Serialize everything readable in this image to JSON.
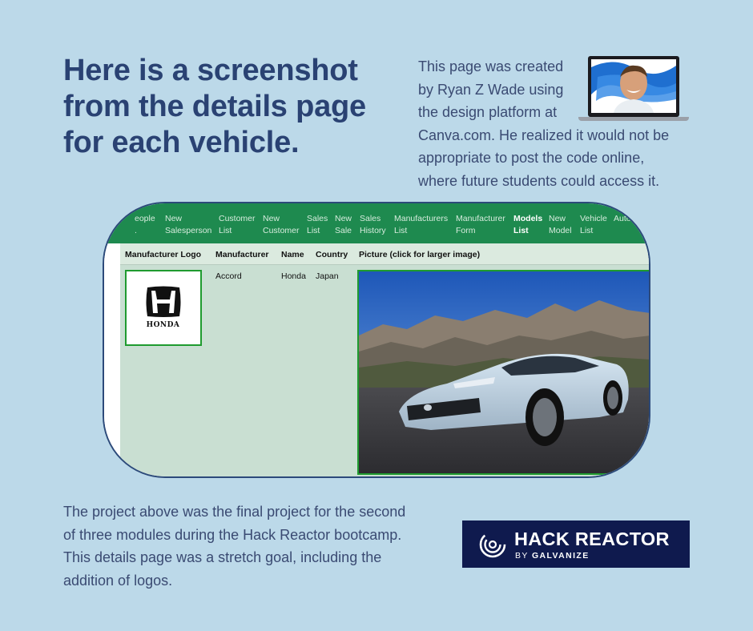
{
  "headline": [
    "Here is a screenshot",
    "from the details page",
    "for each vehicle."
  ],
  "intro": [
    "This page was created",
    "by Ryan Z Wade using",
    "the design platform at",
    "Canva.com. He realized it would not be",
    "appropriate to post the code online,",
    "where future students could access it."
  ],
  "nav": {
    "items": [
      [
        "eople",
        "."
      ],
      [
        "New",
        "Salesperson"
      ],
      [
        "Customer",
        "List"
      ],
      [
        "New",
        "Customer"
      ],
      [
        "Sales",
        "List"
      ],
      [
        "New",
        "Sale"
      ],
      [
        "Sales",
        "History"
      ],
      [
        "Manufacturers",
        "List"
      ],
      [
        "Manufacturer",
        "Form"
      ],
      [
        "Models",
        "List"
      ],
      [
        "New",
        "Model"
      ],
      [
        "Vehicle",
        "List"
      ],
      [
        "",
        "Auto"
      ]
    ],
    "active_index": 9
  },
  "table": {
    "headers": [
      "Manufacturer Logo",
      "Manufacturer",
      "Name",
      "Country",
      "Picture (click for larger image)"
    ],
    "row": {
      "logo_text": "HONDA",
      "manufacturer": "Accord",
      "name": "Honda",
      "country": "Japan"
    }
  },
  "outro": [
    "The project above was the final project for the second",
    "of three modules during the Hack Reactor bootcamp.",
    "This details page was a stretch goal, including the",
    "addition of logos."
  ],
  "badge": {
    "title": "HACK REACTOR",
    "sub_prefix": "BY ",
    "sub_bold": "GALVANIZE"
  },
  "colors": {
    "background": "#bcd9e9",
    "headline": "#2a4273",
    "nav": "#1e8a4f",
    "table": "#c9dfd2",
    "border_highlight": "#1f9b2f",
    "badge": "#0f1a4e"
  }
}
